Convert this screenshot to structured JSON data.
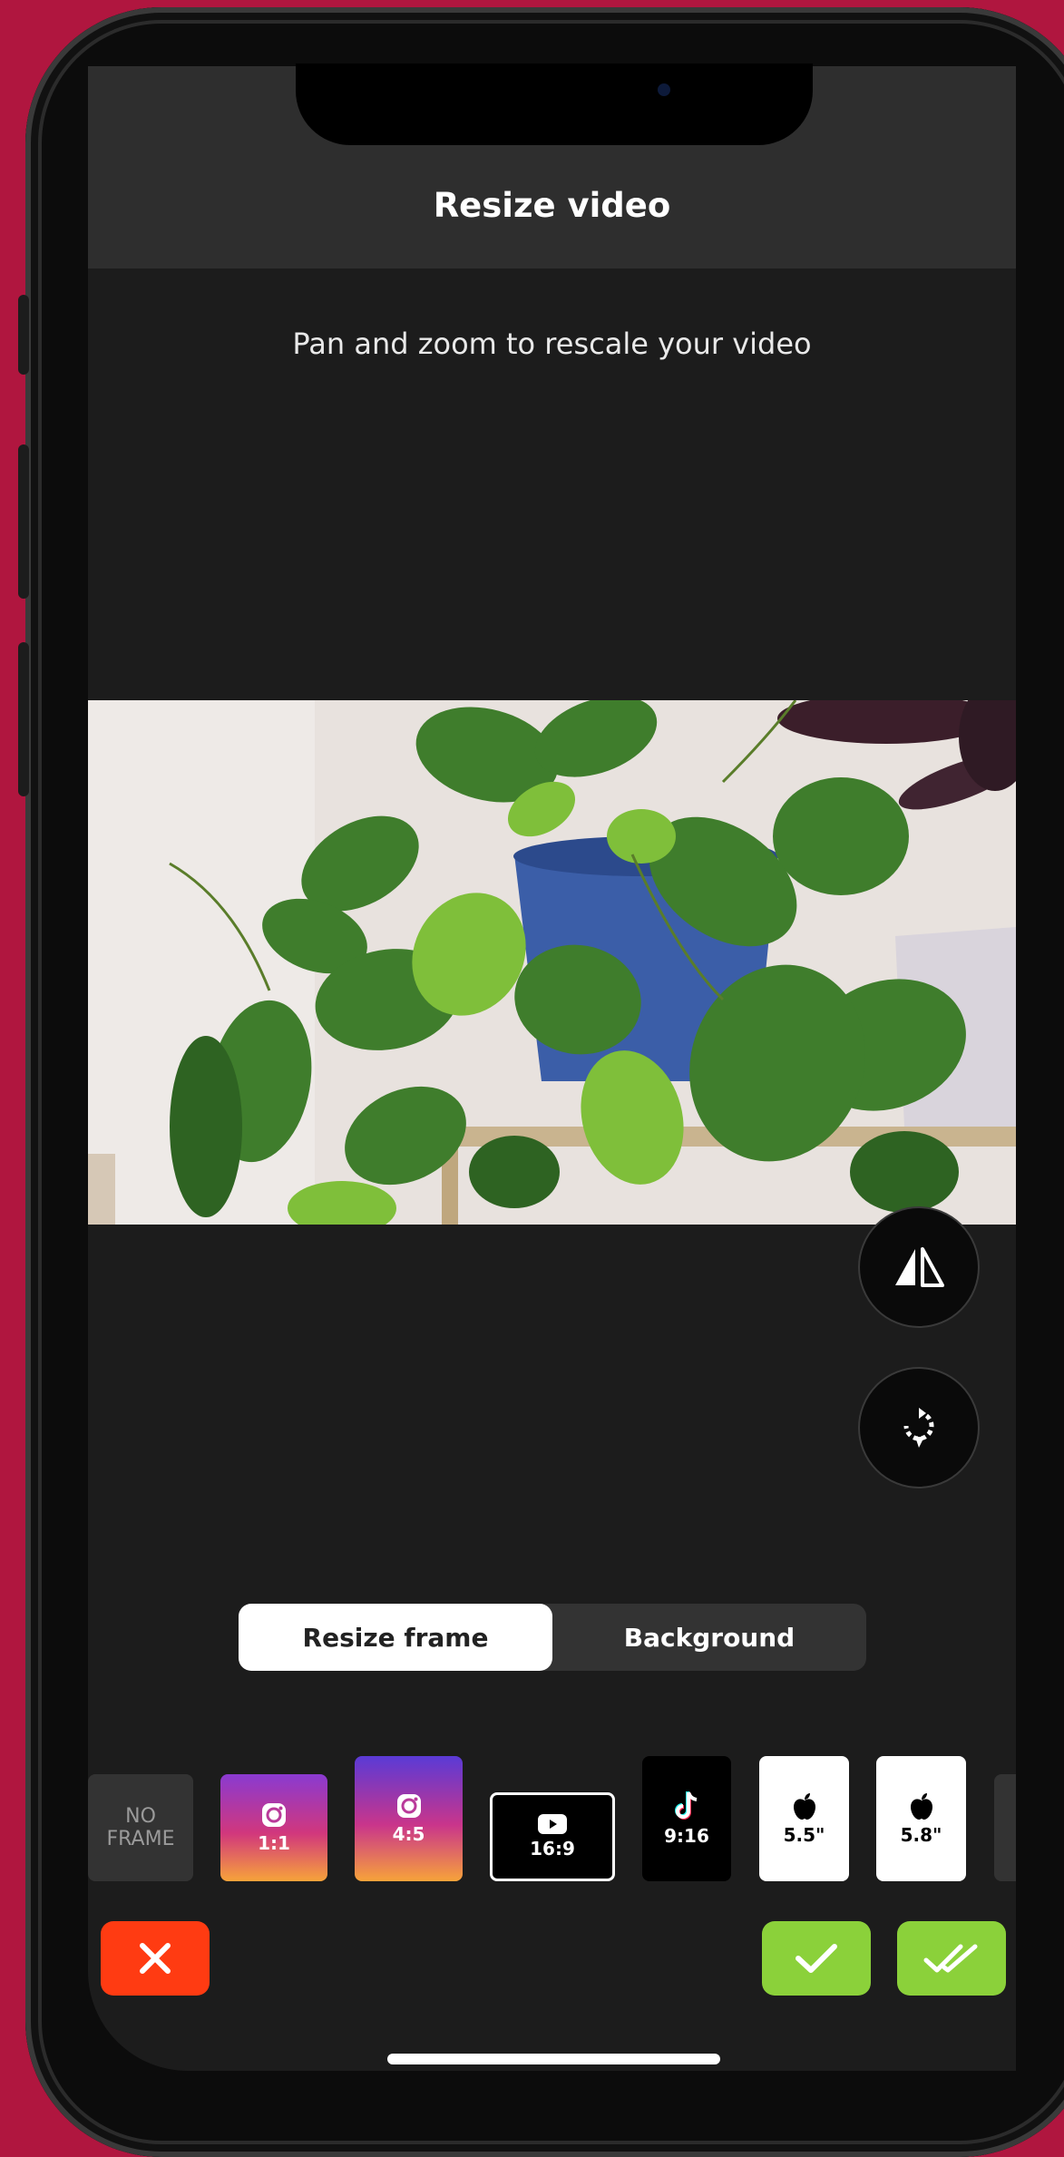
{
  "header": {
    "title": "Resize video"
  },
  "hint_text": "Pan and zoom to rescale your video",
  "tools": {
    "flip_icon": "flip-horizontal-icon",
    "rotate_icon": "rotate-icon"
  },
  "segmented": {
    "options": [
      "Resize frame",
      "Background"
    ],
    "selected": "Resize frame"
  },
  "frames": [
    {
      "id": "no-frame",
      "label_line1": "NO",
      "label_line2": "FRAME"
    },
    {
      "id": "instagram-1-1",
      "label": "1:1",
      "icon": "instagram-icon"
    },
    {
      "id": "instagram-4-5",
      "label": "4:5",
      "icon": "instagram-icon"
    },
    {
      "id": "youtube-16-9",
      "label": "16:9",
      "icon": "youtube-icon"
    },
    {
      "id": "tiktok-9-16",
      "label": "9:16",
      "icon": "tiktok-icon"
    },
    {
      "id": "apple-5-5",
      "label": "5.5\"",
      "icon": "apple-icon"
    },
    {
      "id": "apple-5-8",
      "label": "5.8\"",
      "icon": "apple-icon"
    }
  ],
  "actions": {
    "cancel_icon": "close-icon",
    "apply_icon": "check-icon",
    "apply_all_icon": "double-check-icon"
  },
  "colors": {
    "background": "#b0163f",
    "cancel": "#ff3b12",
    "confirm": "#8bd13a",
    "screen": "#1c1c1c",
    "header": "#2e2e2e"
  }
}
